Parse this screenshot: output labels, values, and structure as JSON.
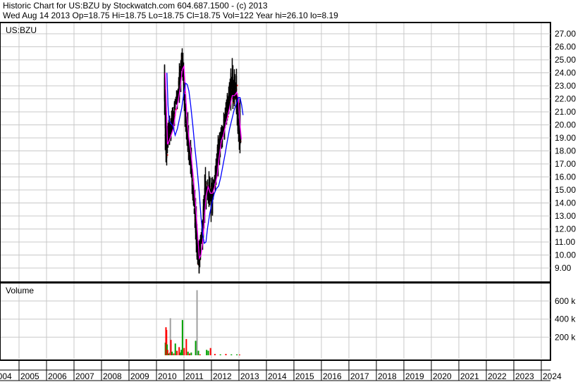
{
  "header": {
    "title": "Historic Chart for US:BZU by Stockwatch.com 604.687.1500 - (c) 2013",
    "quote": "Wed Aug 14 2013  Op=18.75  Hi=18.75  Lo=18.75  Cl=18.75  Vol=122  Year hi=26.10  lo=8.19"
  },
  "chart_data": [
    {
      "type": "line",
      "title": "US:BZU",
      "ylim": [
        8,
        27.8
      ],
      "yticks": [
        "27.00",
        "26.00",
        "25.00",
        "24.00",
        "23.00",
        "22.00",
        "21.00",
        "20.00",
        "19.00",
        "18.00",
        "17.00",
        "16.00",
        "15.00",
        "14.00",
        "13.00",
        "12.00",
        "11.00",
        "10.00",
        "9.00"
      ],
      "x_years": [
        "2004",
        "2005",
        "2006",
        "2007",
        "2008",
        "2009",
        "2010",
        "2011",
        "2012",
        "2013",
        "2014",
        "2015",
        "2016",
        "2017",
        "2018",
        "2019",
        "2020",
        "2021",
        "2022",
        "2023",
        "2024"
      ],
      "series": [
        {
          "name": "price",
          "color": "#000000",
          "points": [
            [
              2010.28,
              25.2,
              20.5,
              24.0
            ],
            [
              2010.32,
              24.5,
              18.0,
              19.0
            ],
            [
              2010.36,
              21.0,
              16.2,
              18.0
            ],
            [
              2010.42,
              20.5,
              18.0,
              19.5
            ],
            [
              2010.5,
              21.0,
              18.5,
              19.0
            ],
            [
              2010.58,
              21.5,
              19.0,
              20.5
            ],
            [
              2010.66,
              22.5,
              20.0,
              21.5
            ],
            [
              2010.74,
              23.0,
              21.0,
              22.0
            ],
            [
              2010.82,
              24.5,
              21.5,
              23.5
            ],
            [
              2010.9,
              26.1,
              23.5,
              25.0
            ],
            [
              2010.96,
              25.5,
              22.5,
              24.0
            ],
            [
              2011.02,
              24.0,
              20.0,
              21.0
            ],
            [
              2011.08,
              22.0,
              18.5,
              19.5
            ],
            [
              2011.14,
              21.0,
              17.5,
              18.5
            ],
            [
              2011.22,
              19.0,
              16.0,
              17.0
            ],
            [
              2011.3,
              17.5,
              14.0,
              15.0
            ],
            [
              2011.38,
              16.0,
              12.5,
              13.0
            ],
            [
              2011.46,
              13.5,
              9.5,
              10.0
            ],
            [
              2011.52,
              11.5,
              8.2,
              9.5
            ],
            [
              2011.58,
              11.5,
              9.0,
              10.5
            ],
            [
              2011.64,
              12.5,
              10.0,
              11.5
            ],
            [
              2011.7,
              14.5,
              11.0,
              13.5
            ],
            [
              2011.76,
              17.0,
              13.0,
              15.5
            ],
            [
              2011.84,
              16.5,
              14.0,
              15.0
            ],
            [
              2011.92,
              16.5,
              13.5,
              14.5
            ],
            [
              2012.0,
              16.0,
              12.0,
              15.0
            ],
            [
              2012.08,
              17.0,
              14.0,
              15.5
            ],
            [
              2012.16,
              17.5,
              15.0,
              16.5
            ],
            [
              2012.24,
              19.5,
              16.0,
              18.5
            ],
            [
              2012.32,
              20.0,
              17.5,
              19.0
            ],
            [
              2012.4,
              20.5,
              18.0,
              19.5
            ],
            [
              2012.48,
              21.5,
              19.0,
              20.5
            ],
            [
              2012.56,
              22.5,
              20.0,
              21.0
            ],
            [
              2012.64,
              23.5,
              20.5,
              22.0
            ],
            [
              2012.72,
              25.4,
              21.5,
              22.5
            ],
            [
              2012.8,
              25.0,
              21.0,
              22.0
            ],
            [
              2012.88,
              24.5,
              21.0,
              23.0
            ],
            [
              2012.94,
              23.5,
              19.5,
              21.0
            ],
            [
              2013.0,
              23.0,
              17.5,
              19.0
            ],
            [
              2013.05,
              20.5,
              18.0,
              18.75
            ]
          ]
        },
        {
          "name": "short moving average",
          "color": "#ff00ff"
        },
        {
          "name": "long moving average",
          "color": "#0000ff"
        }
      ]
    },
    {
      "type": "bar",
      "title": "Volume",
      "yticks": [
        "600 k",
        "400 k",
        "200 k"
      ],
      "bars": [
        [
          2010.3,
          140000,
          "#00a000"
        ],
        [
          2010.32,
          310000,
          "#ff0000"
        ],
        [
          2010.34,
          280000,
          "#ff0000"
        ],
        [
          2010.36,
          120000,
          "#00a000"
        ],
        [
          2010.38,
          60000,
          "#ff0000"
        ],
        [
          2010.42,
          20000,
          "#00a000"
        ],
        [
          2010.46,
          30000,
          "#ff0000"
        ],
        [
          2010.48,
          410000,
          "#a0a0a0"
        ],
        [
          2010.5,
          170000,
          "#ff0000"
        ],
        [
          2010.54,
          40000,
          "#00a000"
        ],
        [
          2010.6,
          20000,
          "#ff0000"
        ],
        [
          2010.66,
          130000,
          "#00a000"
        ],
        [
          2010.72,
          50000,
          "#ff0000"
        ],
        [
          2010.8,
          90000,
          "#ff0000"
        ],
        [
          2010.84,
          30000,
          "#00a000"
        ],
        [
          2010.88,
          60000,
          "#00a000"
        ],
        [
          2010.92,
          390000,
          "#00a000"
        ],
        [
          2010.98,
          80000,
          "#ff0000"
        ],
        [
          2011.06,
          180000,
          "#ff0000"
        ],
        [
          2011.12,
          40000,
          "#00a000"
        ],
        [
          2011.18,
          20000,
          "#ff0000"
        ],
        [
          2011.24,
          30000,
          "#00a000"
        ],
        [
          2011.4,
          160000,
          "#00a000"
        ],
        [
          2011.45,
          720000,
          "#a0a0a0"
        ],
        [
          2011.5,
          50000,
          "#00a000"
        ],
        [
          2011.56,
          10000,
          "#ff0000"
        ],
        [
          2011.8,
          60000,
          "#00a000"
        ],
        [
          2011.86,
          50000,
          "#00a000"
        ],
        [
          2011.94,
          80000,
          "#ff0000"
        ],
        [
          2012.1,
          15000,
          "#ff0000"
        ],
        [
          2012.3,
          10000,
          "#00a000"
        ],
        [
          2012.5,
          15000,
          "#ff0000"
        ],
        [
          2012.7,
          10000,
          "#00a000"
        ],
        [
          2012.9,
          10000,
          "#00a000"
        ],
        [
          2013.0,
          8000,
          "#ff0000"
        ]
      ]
    }
  ]
}
